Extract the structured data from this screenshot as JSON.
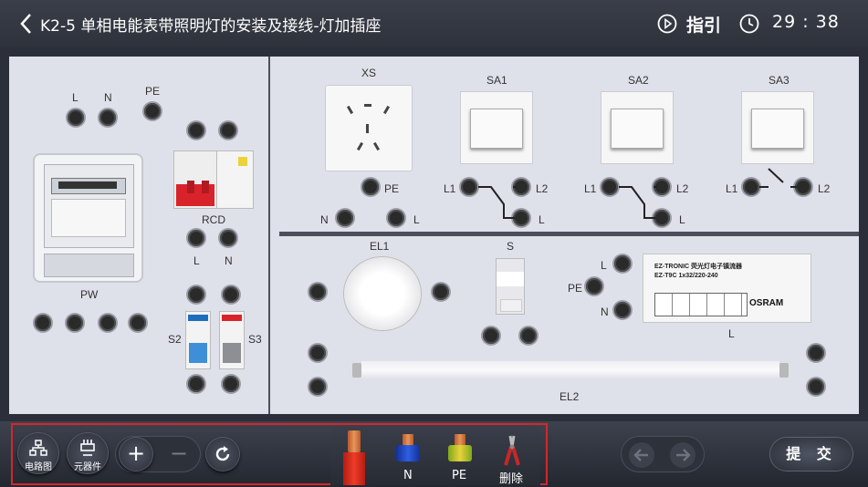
{
  "header": {
    "title": "K2-5 单相电能表带照明灯的安装及接线-灯加插座",
    "guide_label": "指引",
    "timer_text": "29 : 38"
  },
  "board": {
    "left_labels": {
      "top_L": "L",
      "top_N": "N",
      "top_PE": "PE",
      "rcd": "RCD",
      "rcd_L": "L",
      "rcd_N": "N",
      "pw": "PW",
      "s2": "S2",
      "s3": "S3"
    },
    "right_labels": {
      "xs": "XS",
      "xs_pe": "PE",
      "xs_n": "N",
      "xs_l": "L",
      "sa1": "SA1",
      "sa2": "SA2",
      "sa3": "SA3",
      "l1": "L1",
      "l2": "L2",
      "l": "L",
      "el1": "EL1",
      "s": "S",
      "el2": "EL2",
      "ballast_l_top": "L",
      "ballast_pe": "PE",
      "ballast_n": "N",
      "ballast_l_bottom": "L"
    },
    "ballast": {
      "brand": "EZ-TRONIC 荧光灯电子镇流器",
      "model": "EZ-T9C 1x32/220-240",
      "maker": "OSRAM"
    }
  },
  "toolbar": {
    "circuit_label": "电路图",
    "component_label": "元器件",
    "zoom_in": "+",
    "zoom_out": "−",
    "wires": {
      "n": "N",
      "pe": "PE",
      "delete": "删除"
    },
    "submit_label": "提 交"
  }
}
